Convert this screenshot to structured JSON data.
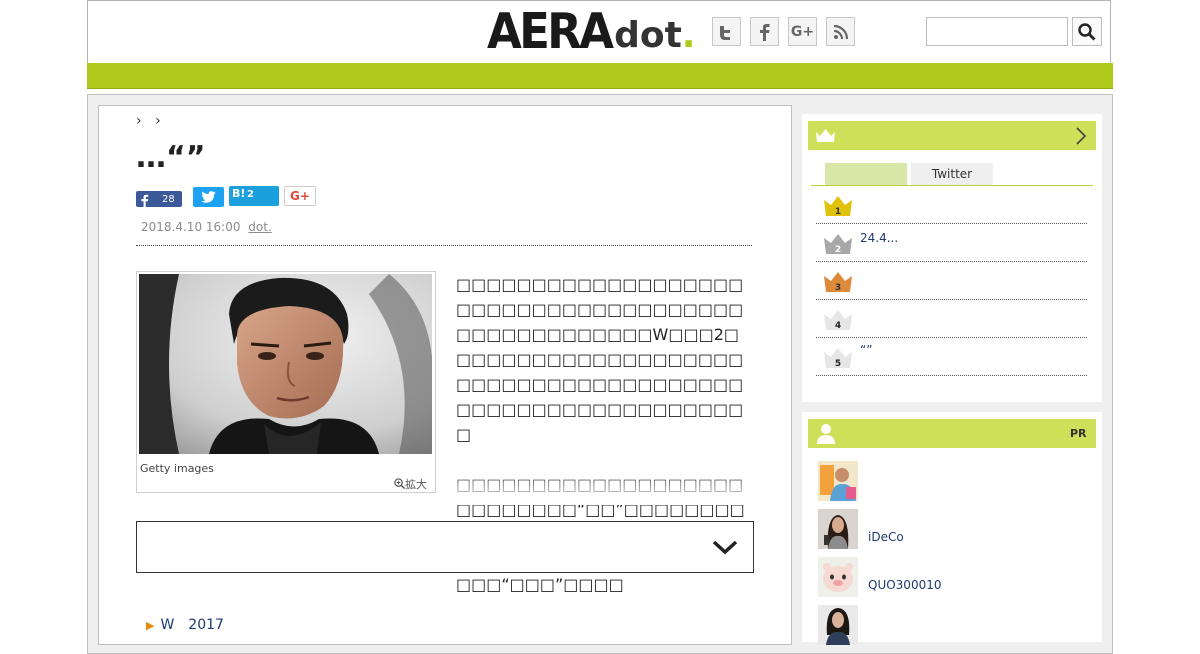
{
  "header": {
    "logo_main": "AERA",
    "logo_dot": "dot",
    "logo_period": ".",
    "sns_icons": [
      "twitter-icon",
      "facebook-icon",
      "google-plus-icon",
      "rss-icon"
    ],
    "search_placeholder": ""
  },
  "colors": {
    "brand_green": "#afca1b",
    "panel_green": "#cee05a",
    "link_blue": "#1e3a6e"
  },
  "article": {
    "breadcrumb_sep": "›",
    "title": "…“”",
    "social": {
      "facebook_count": "28",
      "hatena_label": "B!",
      "hatena_count": "2",
      "googleplus_label": "G+"
    },
    "date": "2018.4.10 16:00",
    "source": "dot.",
    "photo_caption": "Getty images",
    "zoom_label": "拡大",
    "body_p1": "□□□□□□□□□□□□□□□□□□□□□□□□□□□□□□□□□□□□□□□□□□□□□□□□□□□W□□□2□□□□□□□□□□□□□□□□□□□□□□□□□□□□□□□□□□□□□□□□□□□□□□□□□□□□□□□□□□□",
    "body_p2": "□□□□□□□□□□□□□□□□□□□□□□□□□□□“□□”□□□□□□□□□□□□□□□□□□□□□□□□□□□□□□□□□□□□□□□□□□□□□□□□□“□□□”□□□□",
    "related_link": "W　2017"
  },
  "sidebar": {
    "ranking_tabs": [
      "",
      "Twitter"
    ],
    "ranking": [
      {
        "rank": "1",
        "text": ""
      },
      {
        "rank": "2",
        "text": "24.4..."
      },
      {
        "rank": "3",
        "text": ""
      },
      {
        "rank": "4",
        "text": ""
      },
      {
        "rank": "5",
        "text": "“”"
      }
    ],
    "pr_label": "PR",
    "pr_items": [
      "",
      "iDeCo",
      "QUO300010",
      ""
    ]
  }
}
